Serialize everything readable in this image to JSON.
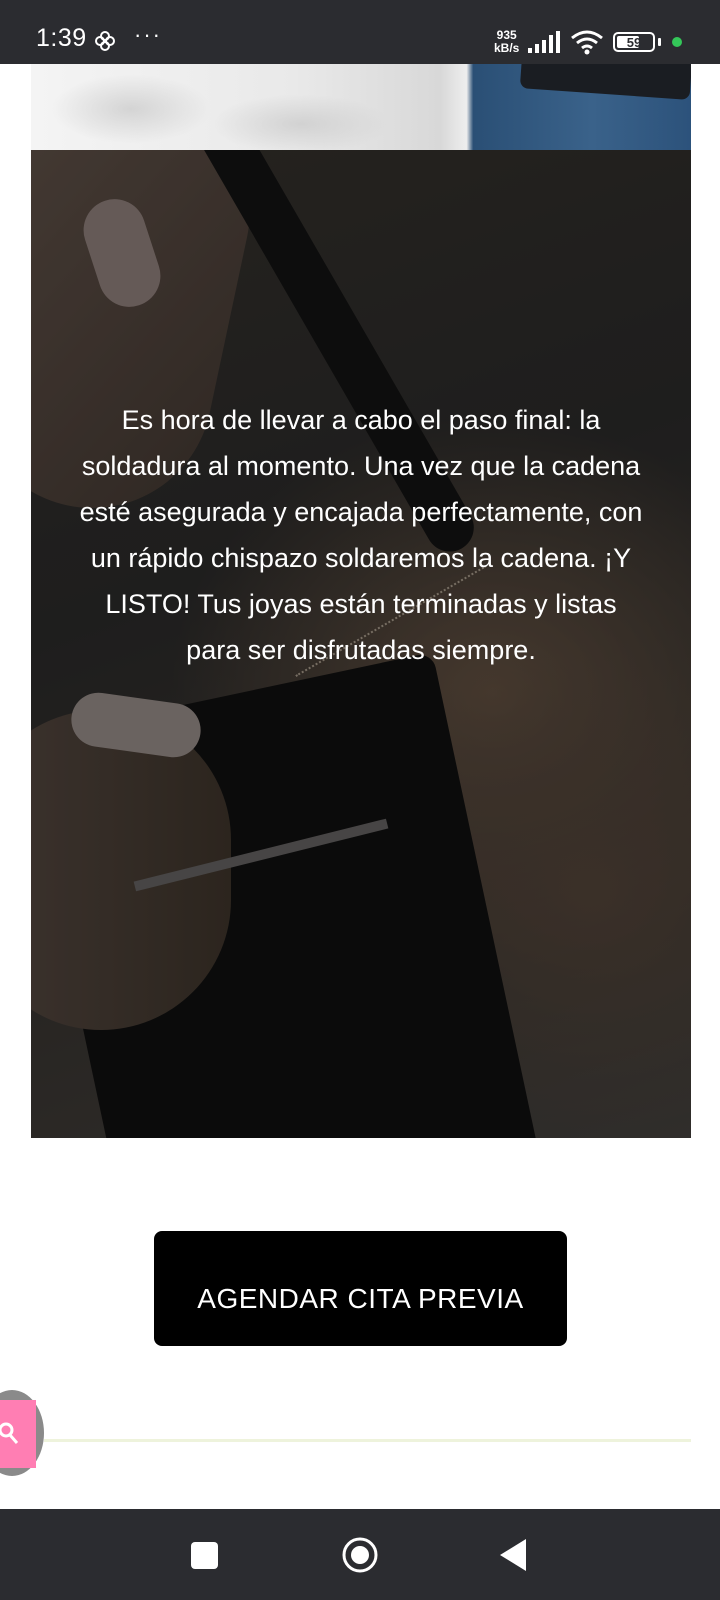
{
  "status_bar": {
    "time": "1:39",
    "more_indicator": "···",
    "net_speed_value": "935",
    "net_speed_unit": "kB/s",
    "battery_level": "59",
    "icons": [
      "fan-icon",
      "signal-icon",
      "wifi-icon",
      "battery-icon",
      "green-dot"
    ]
  },
  "hero": {
    "text": "Es hora de llevar a cabo el paso final: la soldadura al momento. Una vez que la cadena esté asegurada y encajada perfectamente, con un rápido chispazo soldaremos la cadena. ¡Y LISTO! Tus joyas están terminadas y listas para ser disfrutadas siempre."
  },
  "cta": {
    "label": "AGENDAR CITA PREVIA"
  },
  "floating_button": {
    "icon": "search-icon",
    "color": "#ff7eb3"
  },
  "nav_bar": {
    "icons": [
      "recent-apps-icon",
      "home-icon",
      "back-icon"
    ]
  }
}
